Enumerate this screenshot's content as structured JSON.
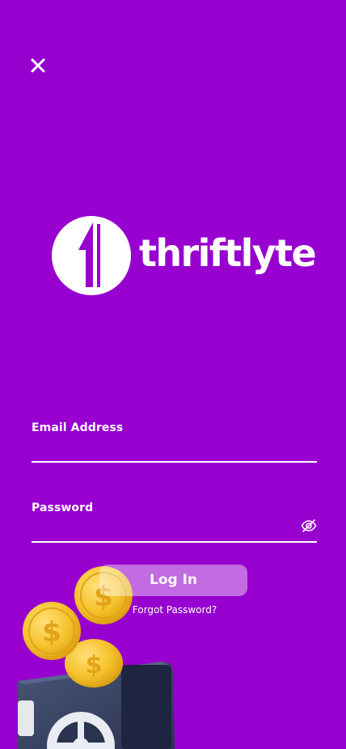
{
  "app": {
    "brand_name": "thriftlyte"
  },
  "header": {
    "close_icon": "close-icon"
  },
  "form": {
    "email": {
      "label": "Email Address",
      "value": ""
    },
    "password": {
      "label": "Password",
      "value": "",
      "toggle_icon": "eye-off-icon"
    },
    "login_label": "Log In",
    "forgot_label": "Forgot Password?"
  },
  "illustration": {
    "icon": "coins-safe-illustration",
    "coin_symbol": "$"
  },
  "colors": {
    "background": "#9700CF",
    "text": "#FFFFFF",
    "coin": "#F5C22B",
    "safe": "#3B4565"
  }
}
